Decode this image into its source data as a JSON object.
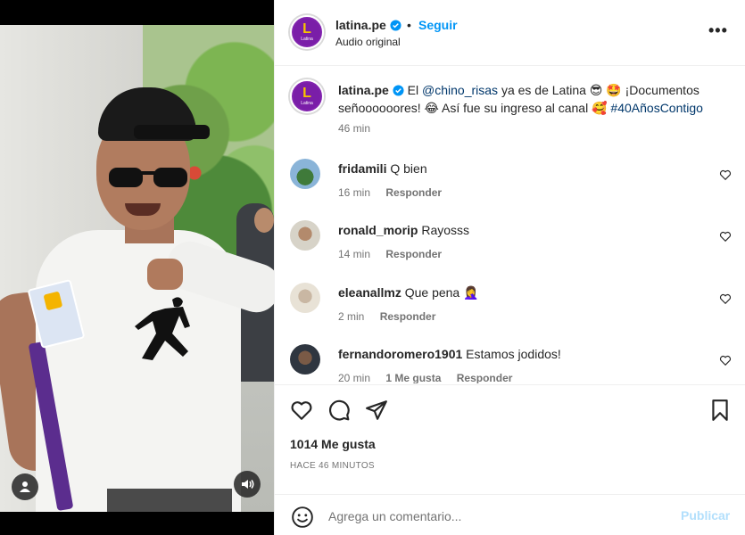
{
  "header": {
    "username": "latina.pe",
    "separator": "•",
    "follow_label": "Seguir",
    "subtitle": "Audio original",
    "more_label": "•••",
    "avatar_letter": "L",
    "avatar_sub": "Latina"
  },
  "caption": {
    "username": "latina.pe",
    "text_before": " El ",
    "mention": "@chino_risas",
    "text_middle": " ya es de Latina 😎 🤩 ¡Documentos señoooooores! 😂 Así fue su ingreso al canal 🥰 ",
    "hashtag": "#40AñosContigo",
    "time": "46 min"
  },
  "comments": [
    {
      "username": "fridamili",
      "text": "Q bien",
      "time": "16 min",
      "likes": "",
      "reply_label": "Responder"
    },
    {
      "username": "ronald_morip",
      "text": "Rayosss",
      "time": "14 min",
      "likes": "",
      "reply_label": "Responder"
    },
    {
      "username": "eleanallmz",
      "text": "Que pena 🤦‍♀️",
      "time": "2 min",
      "likes": "",
      "reply_label": "Responder"
    },
    {
      "username": "fernandoromero1901",
      "text": "Estamos jodidos!",
      "time": "20 min",
      "likes": "1 Me gusta",
      "reply_label": "Responder"
    }
  ],
  "stats": {
    "likes": "1014 Me gusta",
    "posted": "HACE 46 MINUTOS"
  },
  "add_comment": {
    "placeholder": "Agrega un comentario...",
    "publish_label": "Publicar"
  },
  "colors": {
    "accent": "#0095f6",
    "brand": "#7a1ea8",
    "publish_disabled": "#b2dffc"
  }
}
